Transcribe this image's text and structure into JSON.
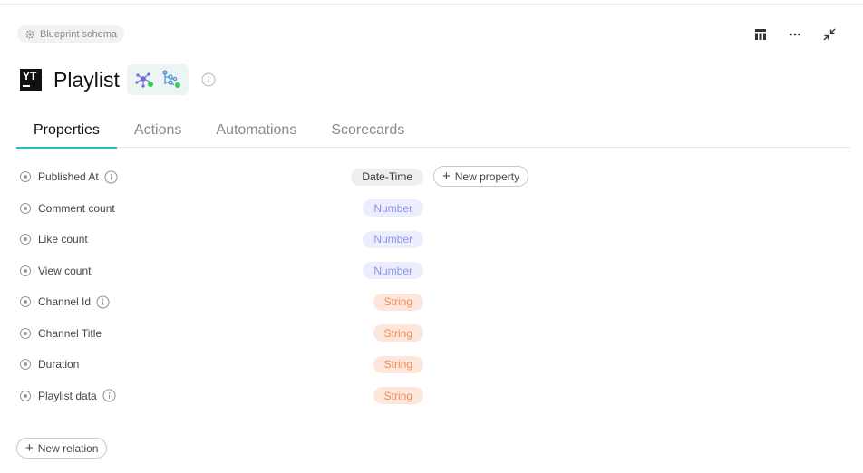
{
  "header": {
    "chip_label": "Blueprint schema",
    "title": "Playlist",
    "logo_text": "YT"
  },
  "top_actions": [
    {
      "name": "table-icon"
    },
    {
      "name": "more-icon"
    },
    {
      "name": "collapse-icon"
    }
  ],
  "tabs": [
    {
      "label": "Properties",
      "active": true
    },
    {
      "label": "Actions",
      "active": false
    },
    {
      "label": "Automations",
      "active": false
    },
    {
      "label": "Scorecards",
      "active": false
    }
  ],
  "properties": [
    {
      "name": "Published At",
      "type": "Date-Time",
      "kind": "dt",
      "info": true
    },
    {
      "name": "Comment count",
      "type": "Number",
      "kind": "num",
      "info": false
    },
    {
      "name": "Like count",
      "type": "Number",
      "kind": "num",
      "info": false
    },
    {
      "name": "View count",
      "type": "Number",
      "kind": "num",
      "info": false
    },
    {
      "name": "Channel Id",
      "type": "String",
      "kind": "str",
      "info": true
    },
    {
      "name": "Channel Title",
      "type": "String",
      "kind": "str",
      "info": false
    },
    {
      "name": "Duration",
      "type": "String",
      "kind": "str",
      "info": false
    },
    {
      "name": "Playlist data",
      "type": "String",
      "kind": "str",
      "info": true
    }
  ],
  "buttons": {
    "new_property": "New property",
    "new_relation": "New relation"
  },
  "colors": {
    "tab_active_underline": "#26b9c7",
    "number_badge_bg": "#eceefe",
    "number_badge_text": "#8b93e8",
    "string_badge_bg": "#fde6da",
    "string_badge_text": "#ef8c57",
    "datetime_badge_bg": "#efefef"
  }
}
